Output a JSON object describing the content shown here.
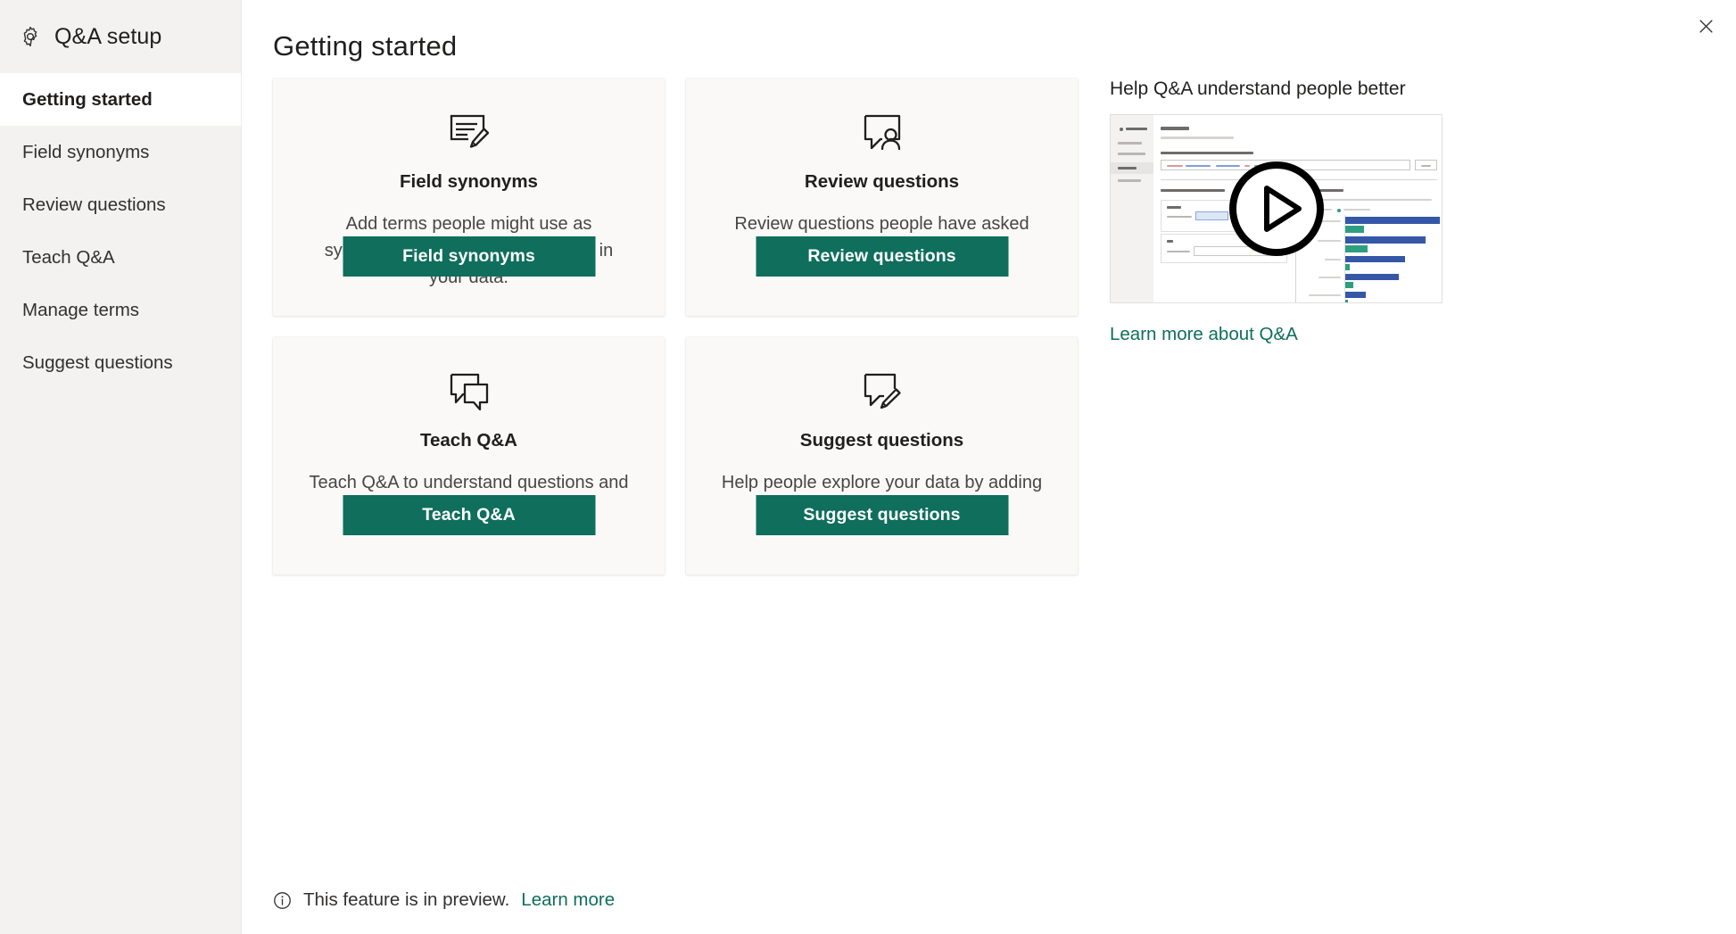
{
  "sidebar": {
    "header": {
      "icon": "gear-icon",
      "title": "Q&A setup"
    },
    "items": [
      {
        "label": "Getting started",
        "active": true
      },
      {
        "label": "Field synonyms",
        "active": false
      },
      {
        "label": "Review questions",
        "active": false
      },
      {
        "label": "Teach Q&A",
        "active": false
      },
      {
        "label": "Manage terms",
        "active": false
      },
      {
        "label": "Suggest questions",
        "active": false
      }
    ]
  },
  "header": {
    "title": "Getting started",
    "close_icon": "close-icon"
  },
  "cards": [
    {
      "icon": "field-synonyms-icon",
      "title": "Field synonyms",
      "description": "Add terms people might use as synonyms for the fields and tables in your data.",
      "button_label": "Field synonyms"
    },
    {
      "icon": "review-questions-icon",
      "title": "Review questions",
      "description": "Review questions people have asked and fix misunderstandings.",
      "button_label": "Review questions"
    },
    {
      "icon": "teach-qa-icon",
      "title": "Teach Q&A",
      "description": "Teach Q&A to understand questions and terms people might use.",
      "button_label": "Teach Q&A"
    },
    {
      "icon": "suggest-questions-icon",
      "title": "Suggest questions",
      "description": "Help people explore your data by adding suggested questions.",
      "button_label": "Suggest questions"
    }
  ],
  "help": {
    "title": "Help Q&A understand people better",
    "video": {
      "play_icon": "play-icon",
      "thumbnail_alt": "Teach Q&A screen preview"
    },
    "link_label": "Learn more about Q&A"
  },
  "footer": {
    "icon": "info-icon",
    "text": "This feature is in preview.",
    "link_label": "Learn more"
  },
  "colors": {
    "accent": "#0f6e5c",
    "sidebar_bg": "#f3f2f1",
    "card_bg": "#faf9f8",
    "text": "#201f1e",
    "muted_text": "#484644",
    "chart_blue": "#3557a8",
    "chart_green": "#2e9e83"
  }
}
